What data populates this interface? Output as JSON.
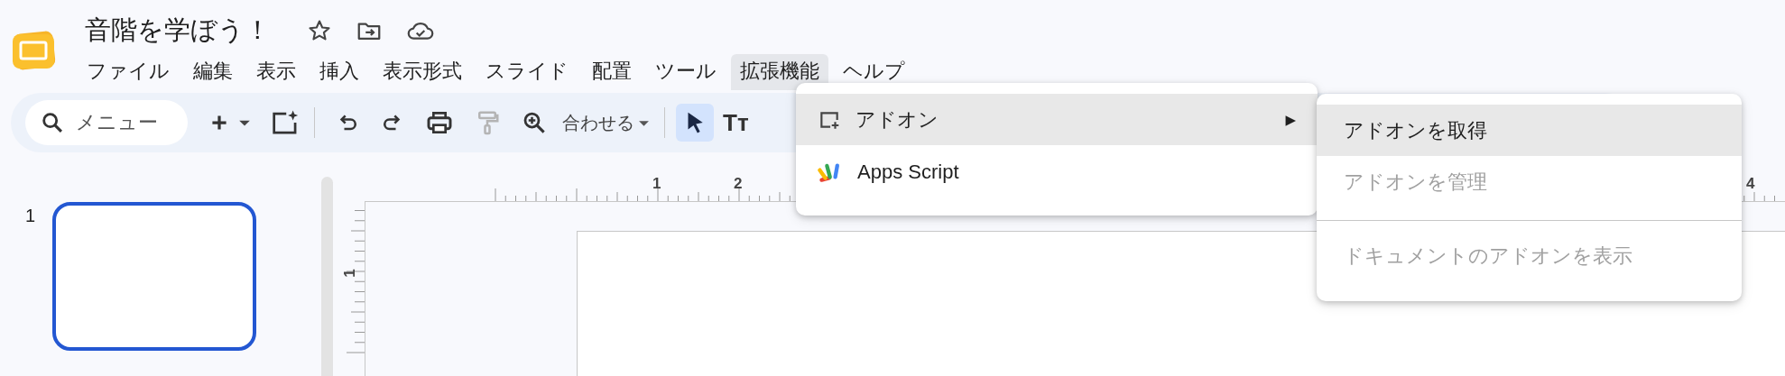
{
  "document": {
    "title": "音階を学ぼう！"
  },
  "menubar": [
    {
      "label": "ファイル",
      "selected": false
    },
    {
      "label": "編集",
      "selected": false
    },
    {
      "label": "表示",
      "selected": false
    },
    {
      "label": "挿入",
      "selected": false
    },
    {
      "label": "表示形式",
      "selected": false
    },
    {
      "label": "スライド",
      "selected": false
    },
    {
      "label": "配置",
      "selected": false
    },
    {
      "label": "ツール",
      "selected": false
    },
    {
      "label": "拡張機能",
      "selected": true
    },
    {
      "label": "ヘルプ",
      "selected": false
    }
  ],
  "toolbar": {
    "search": {
      "placeholder": "メニュー"
    },
    "paint_format": {
      "disabled": true
    },
    "zoom": {
      "label": "合わせる"
    },
    "select_tool": {
      "selected": true
    },
    "text_tool": {
      "glyph": "Tт"
    }
  },
  "rulers": {
    "horizontal": [
      "1",
      "2",
      "4"
    ],
    "vertical": [
      "1"
    ]
  },
  "slides": [
    {
      "number": "1",
      "selected": true
    }
  ],
  "extensions_menu": [
    {
      "kind": "submenu",
      "label": "アドオン",
      "arrow": "▶",
      "selected": true
    },
    {
      "kind": "app",
      "label": "Apps Script",
      "selected": false
    }
  ],
  "addons_submenu": [
    {
      "label": "アドオンを取得",
      "selected": true,
      "disabled": false
    },
    {
      "label": "アドオンを管理",
      "selected": false,
      "disabled": true
    },
    {
      "label": "ドキュメントのアドオンを表示",
      "selected": false,
      "disabled": true,
      "divider_before": true
    }
  ]
}
